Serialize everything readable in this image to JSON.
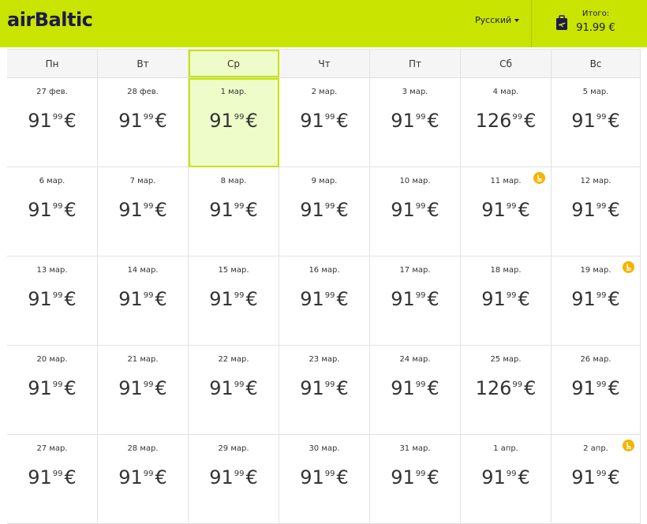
{
  "header": {
    "logo": "airBaltic",
    "language": "Русский",
    "total_label": "Итого:",
    "total_value": "91.99 €",
    "colors": {
      "bar": "#c8e400",
      "brand_text": "#1d1a4a",
      "badge": "#f4b400"
    },
    "cart_icon": "boarding-pass-icon"
  },
  "calendar": {
    "day_headers": [
      "Пн",
      "Вт",
      "Ср",
      "Чт",
      "Пт",
      "Сб",
      "Вс"
    ],
    "selected_column": 2,
    "weeks": [
      [
        {
          "date": "27 фев.",
          "whole": "91",
          "cents": "99",
          "currency": "€"
        },
        {
          "date": "28 фев.",
          "whole": "91",
          "cents": "99",
          "currency": "€"
        },
        {
          "date": "1 мар.",
          "whole": "91",
          "cents": "99",
          "currency": "€",
          "selected": true
        },
        {
          "date": "2 мар.",
          "whole": "91",
          "cents": "99",
          "currency": "€"
        },
        {
          "date": "3 мар.",
          "whole": "91",
          "cents": "99",
          "currency": "€"
        },
        {
          "date": "4 мар.",
          "whole": "126",
          "cents": "99",
          "currency": "€"
        },
        {
          "date": "5 мар.",
          "whole": "91",
          "cents": "99",
          "currency": "€"
        }
      ],
      [
        {
          "date": "6 мар.",
          "whole": "91",
          "cents": "99",
          "currency": "€"
        },
        {
          "date": "7 мар.",
          "whole": "91",
          "cents": "99",
          "currency": "€"
        },
        {
          "date": "8 мар.",
          "whole": "91",
          "cents": "99",
          "currency": "€"
        },
        {
          "date": "9 мар.",
          "whole": "91",
          "cents": "99",
          "currency": "€"
        },
        {
          "date": "10 мар.",
          "whole": "91",
          "cents": "99",
          "currency": "€"
        },
        {
          "date": "11 мар.",
          "whole": "91",
          "cents": "99",
          "currency": "€",
          "badge": true
        },
        {
          "date": "12 мар.",
          "whole": "91",
          "cents": "99",
          "currency": "€"
        }
      ],
      [
        {
          "date": "13 мар.",
          "whole": "91",
          "cents": "99",
          "currency": "€"
        },
        {
          "date": "14 мар.",
          "whole": "91",
          "cents": "99",
          "currency": "€"
        },
        {
          "date": "15 мар.",
          "whole": "91",
          "cents": "99",
          "currency": "€"
        },
        {
          "date": "16 мар.",
          "whole": "91",
          "cents": "99",
          "currency": "€"
        },
        {
          "date": "17 мар.",
          "whole": "91",
          "cents": "99",
          "currency": "€"
        },
        {
          "date": "18 мар.",
          "whole": "91",
          "cents": "99",
          "currency": "€"
        },
        {
          "date": "19 мар.",
          "whole": "91",
          "cents": "99",
          "currency": "€",
          "badge": true
        }
      ],
      [
        {
          "date": "20 мар.",
          "whole": "91",
          "cents": "99",
          "currency": "€"
        },
        {
          "date": "21 мар.",
          "whole": "91",
          "cents": "99",
          "currency": "€"
        },
        {
          "date": "22 мар.",
          "whole": "91",
          "cents": "99",
          "currency": "€"
        },
        {
          "date": "23 мар.",
          "whole": "91",
          "cents": "99",
          "currency": "€"
        },
        {
          "date": "24 мар.",
          "whole": "91",
          "cents": "99",
          "currency": "€"
        },
        {
          "date": "25 мар.",
          "whole": "126",
          "cents": "99",
          "currency": "€"
        },
        {
          "date": "26 мар.",
          "whole": "91",
          "cents": "99",
          "currency": "€"
        }
      ],
      [
        {
          "date": "27 мар.",
          "whole": "91",
          "cents": "99",
          "currency": "€"
        },
        {
          "date": "28 мар.",
          "whole": "91",
          "cents": "99",
          "currency": "€"
        },
        {
          "date": "29 мар.",
          "whole": "91",
          "cents": "99",
          "currency": "€"
        },
        {
          "date": "30 мар.",
          "whole": "91",
          "cents": "99",
          "currency": "€"
        },
        {
          "date": "31 мар.",
          "whole": "91",
          "cents": "99",
          "currency": "€"
        },
        {
          "date": "1 апр.",
          "whole": "91",
          "cents": "99",
          "currency": "€"
        },
        {
          "date": "2 апр.",
          "whole": "91",
          "cents": "99",
          "currency": "€",
          "badge": true
        }
      ]
    ]
  }
}
